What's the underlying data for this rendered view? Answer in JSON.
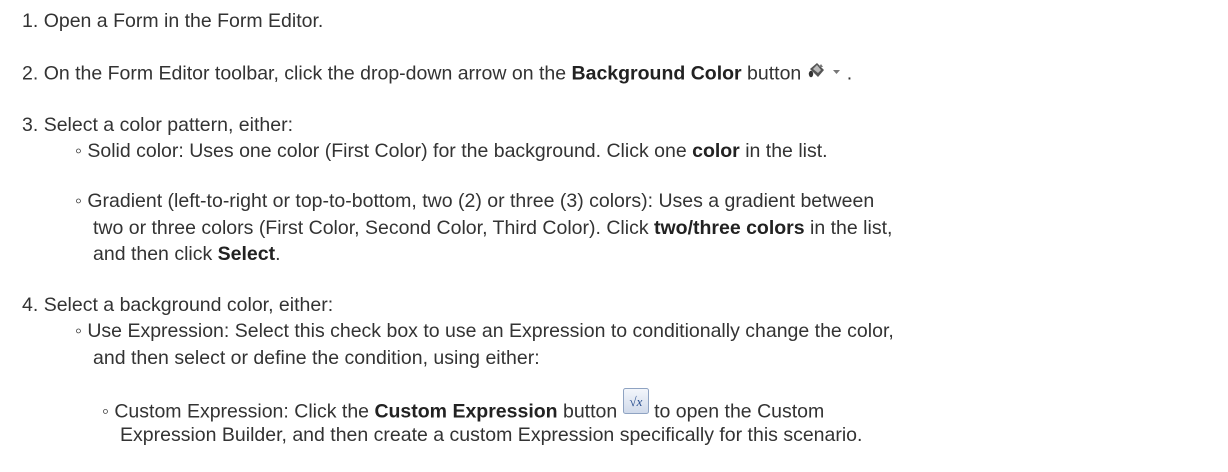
{
  "steps": [
    {
      "num": "1.",
      "text": "Open a Form in the Form Editor."
    },
    {
      "num": "2.",
      "pre": "On the Form Editor toolbar, click the drop-down arrow on the ",
      "bold": "Background Color",
      "post": " button",
      "tail": ".",
      "icon": "paint-bucket-dropdown-icon"
    },
    {
      "num": "3.",
      "text": "Select a color pattern, either:",
      "subitems": [
        {
          "pre": "Solid color: Uses one color (First Color) for the background. Click one ",
          "bold": "color",
          "post": " in the list."
        },
        {
          "line1": "Gradient (left-to-right or top-to-bottom, two (2) or three (3) colors): Uses a gradient between",
          "line2_pre": "two or three colors (First Color, Second Color, Third Color). Click ",
          "line2_bold": "two/three colors",
          "line2_post": " in the list,",
          "line3_pre": "and then click ",
          "line3_bold": "Select",
          "line3_post": "."
        }
      ]
    },
    {
      "num": "4.",
      "text": "Select a background color, either:",
      "subitems": [
        {
          "line1": "Use Expression: Select this check box to use an Expression to conditionally change the color,",
          "line2": "and then select or define the condition, using either:",
          "subitems": [
            {
              "pre": "Custom Expression: Click the ",
              "bold": "Custom Expression",
              "post": " button",
              "tail": "to open the Custom",
              "icon": "custom-expression-icon",
              "line2": "Expression Builder, and then create a custom Expression specifically for this scenario."
            }
          ]
        }
      ]
    }
  ],
  "bullet_char": "◦",
  "icon_label": "√x"
}
